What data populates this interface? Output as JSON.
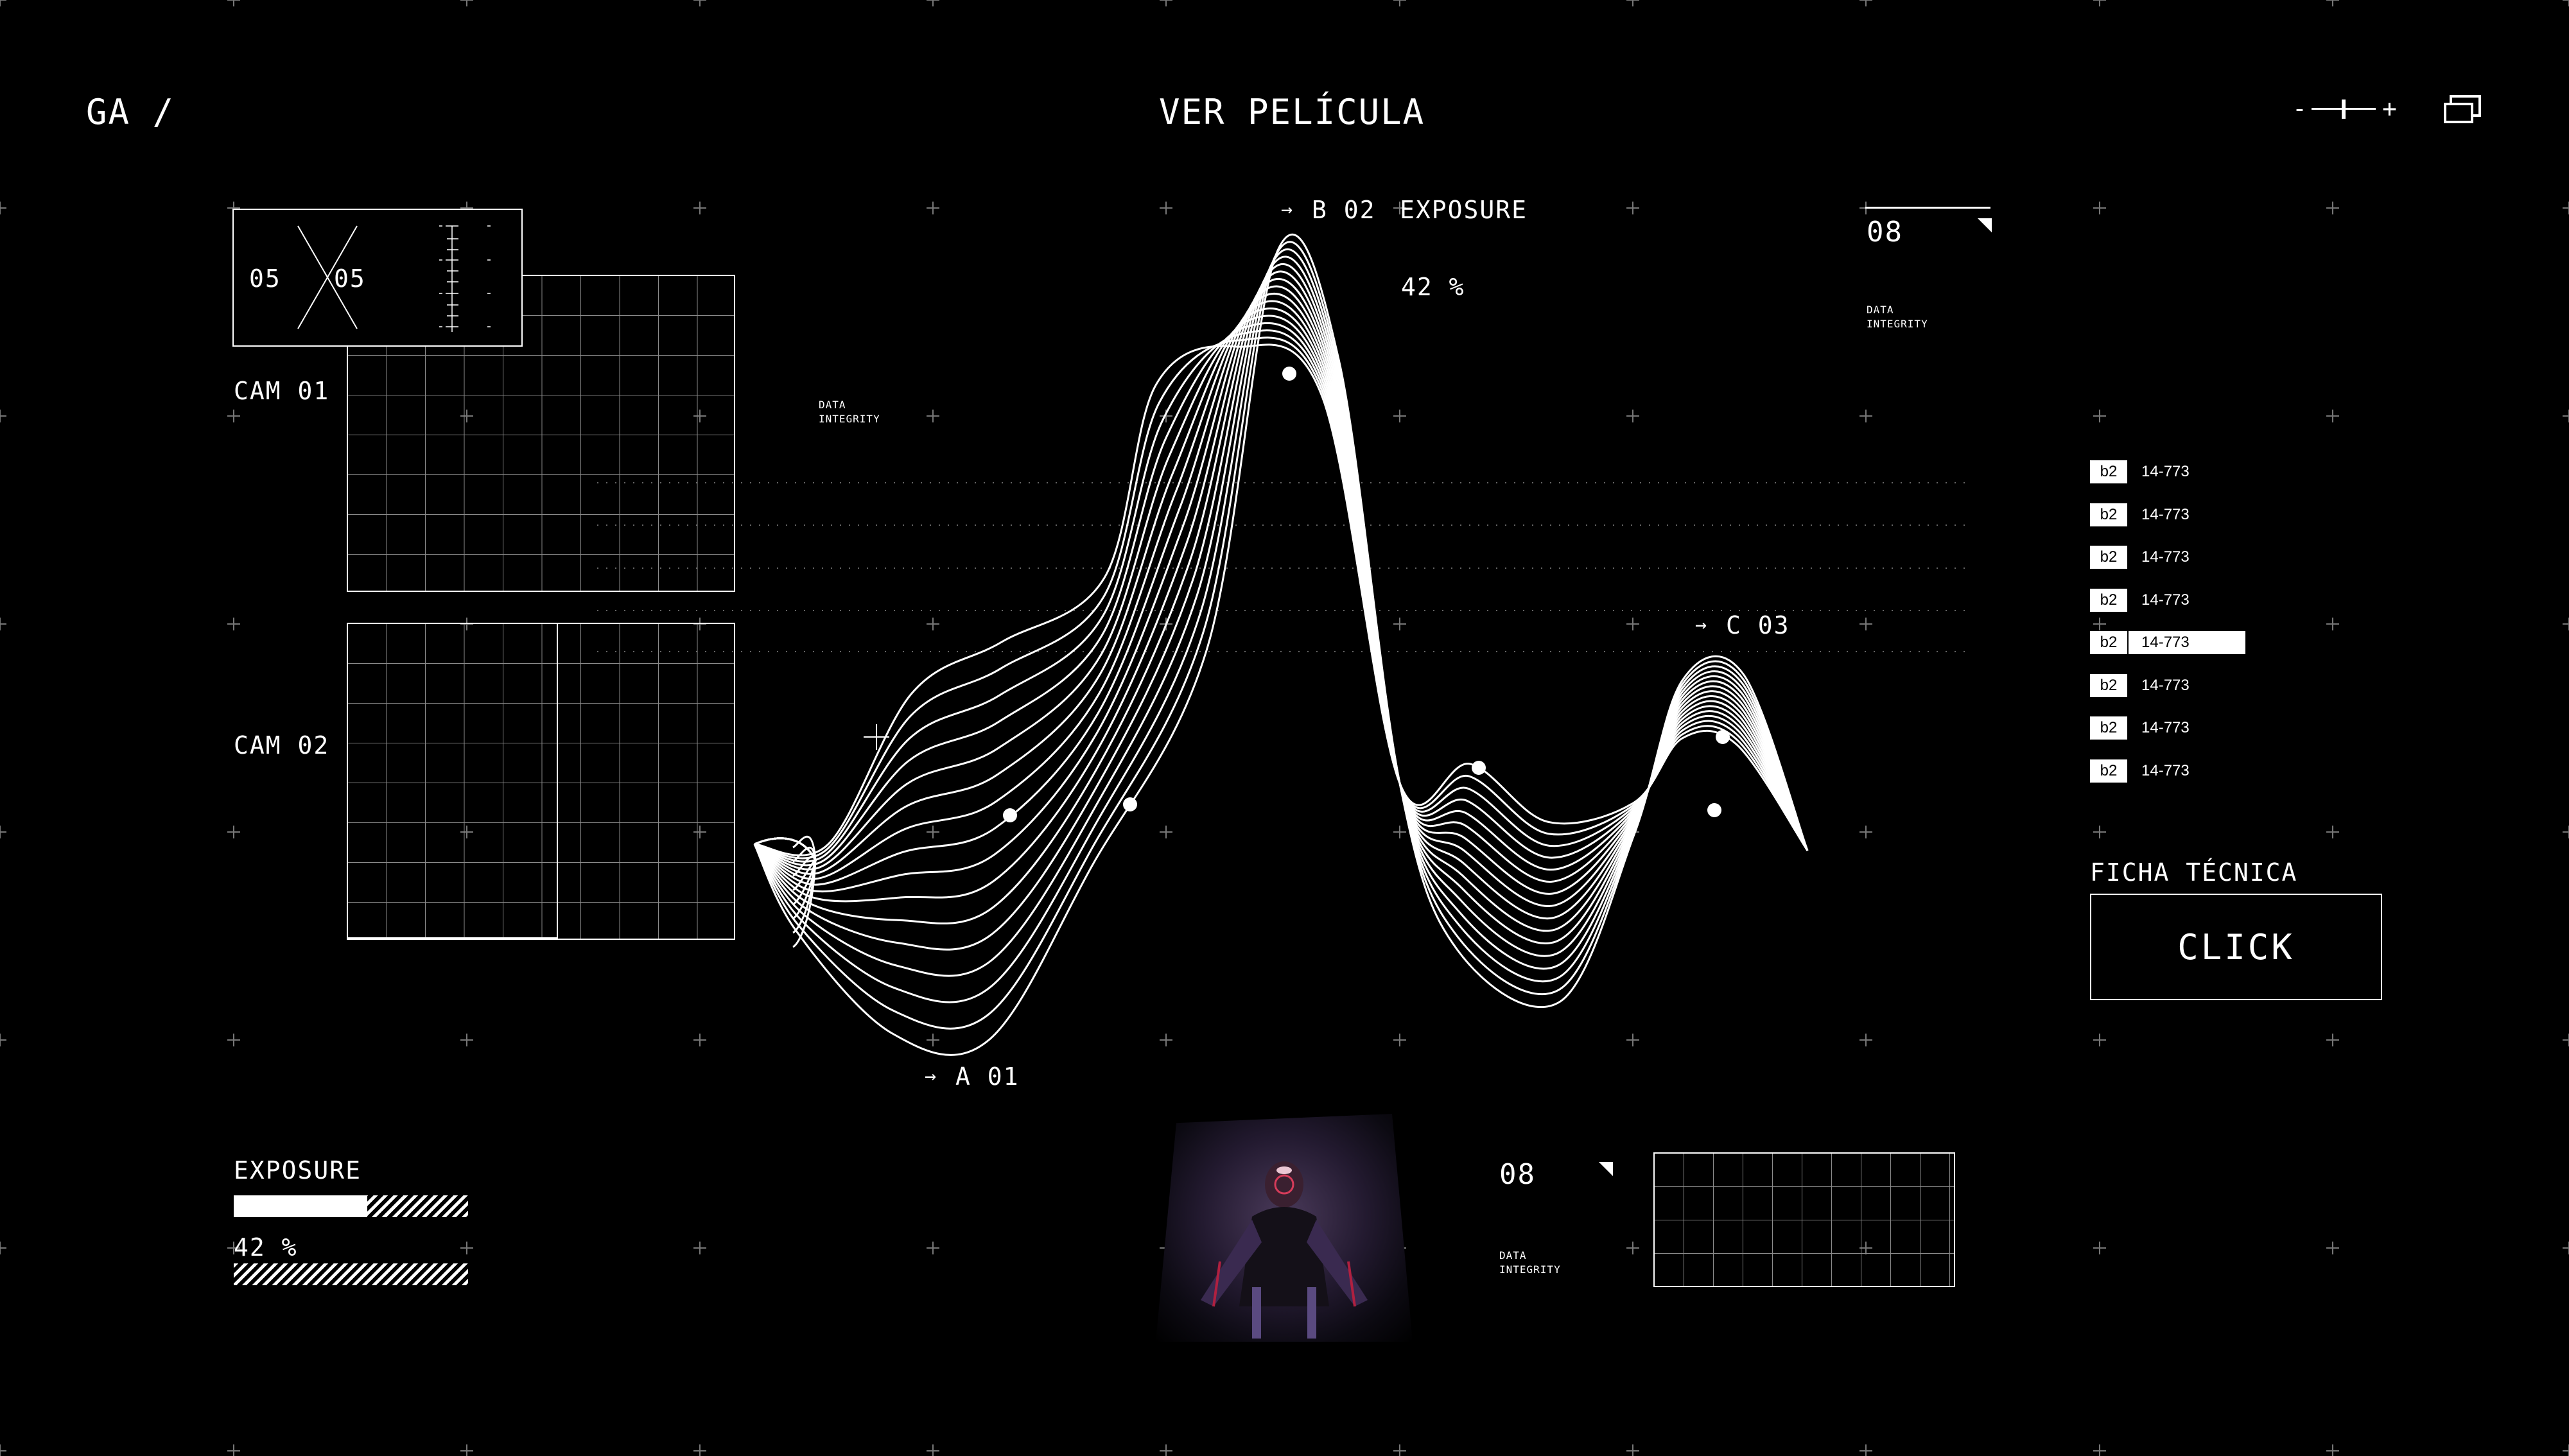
{
  "header": {
    "logo": "GA /",
    "title": "VER PELÍCULA",
    "zoom_minus": "-",
    "zoom_plus": "+",
    "zoom_level": 0.5
  },
  "cam_widget": {
    "left_value": "05",
    "right_value": "05"
  },
  "cams": {
    "cam1_label": "CAM 01",
    "cam2_label": "CAM 02"
  },
  "wave": {
    "marker_b": "B 02",
    "marker_a": "A 01",
    "marker_c": "C 03",
    "arrow": "→",
    "exposure_label": "EXPOSURE",
    "exposure_value": "42 %",
    "data_integrity": "DATA INTEGRITY"
  },
  "top_right_panel": {
    "value": "08",
    "label": "DATA INTEGRITY"
  },
  "list": {
    "items": [
      {
        "tag": "b2",
        "code": "14-773"
      },
      {
        "tag": "b2",
        "code": "14-773"
      },
      {
        "tag": "b2",
        "code": "14-773"
      },
      {
        "tag": "b2",
        "code": "14-773"
      },
      {
        "tag": "b2",
        "code": "14-773"
      },
      {
        "tag": "b2",
        "code": "14-773"
      },
      {
        "tag": "b2",
        "code": "14-773"
      },
      {
        "tag": "b2",
        "code": "14-773"
      }
    ],
    "active_index": 4
  },
  "ficha": {
    "title": "FICHA TÉCNICA",
    "button": "CLICK"
  },
  "exposure_panel": {
    "label": "EXPOSURE",
    "value": "42 %",
    "level": 0.57
  },
  "bottom_panel": {
    "value": "08",
    "label": "DATA INTEGRITY"
  },
  "colors": {
    "background": "#000000",
    "foreground": "#ffffff",
    "grid": "#8a8a8a"
  },
  "icons": {
    "window": "window-icon",
    "cross": "x-cross-icon"
  }
}
